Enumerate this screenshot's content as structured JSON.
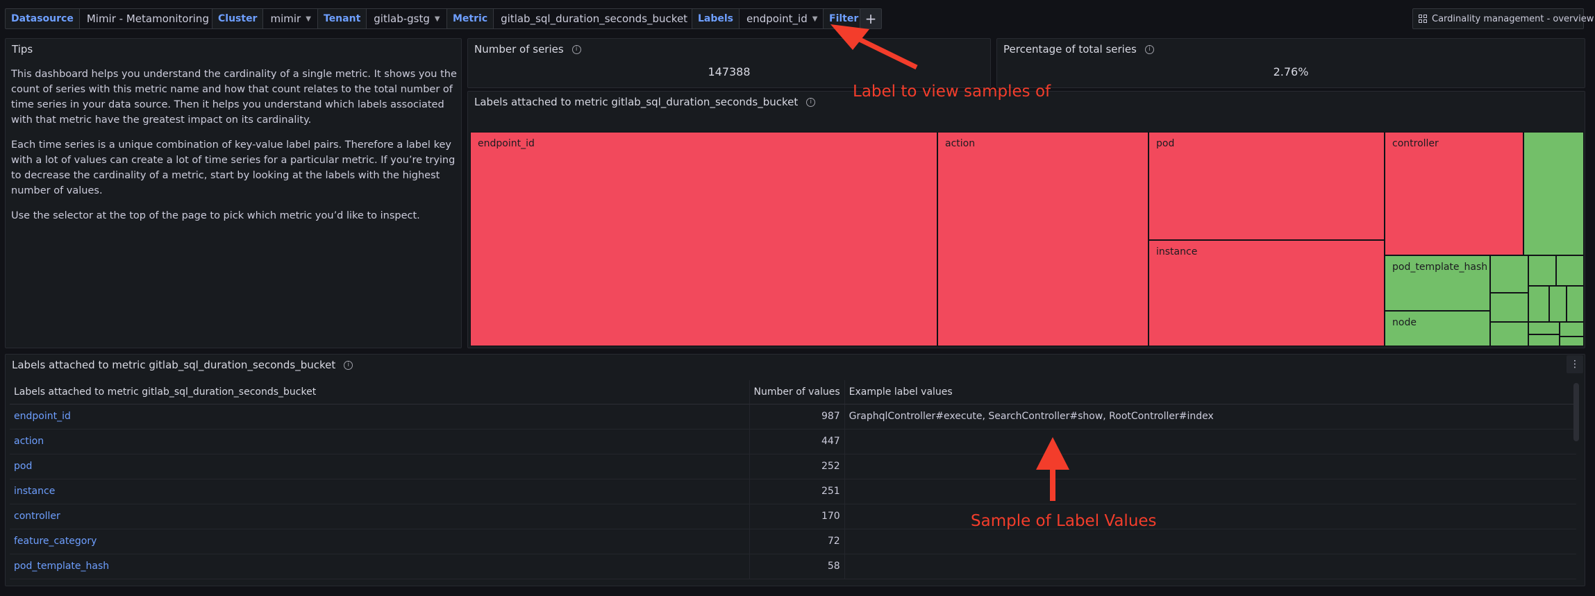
{
  "variables": [
    {
      "label": "Datasource",
      "value": "Mimir - Metamonitoring"
    },
    {
      "label": "Cluster",
      "value": "mimir"
    },
    {
      "label": "Tenant",
      "value": "gitlab-gstg"
    },
    {
      "label": "Metric",
      "value": "gitlab_sql_duration_seconds_bucket"
    },
    {
      "label": "Labels",
      "value": "endpoint_id"
    }
  ],
  "filter_label": "Filter",
  "add_filter_symbol": "+",
  "nav_button": "Cardinality management - overview",
  "tips": {
    "title": "Tips",
    "paragraphs": [
      "This dashboard helps you understand the cardinality of a single metric. It shows you the count of series with this metric name and how that count relates to the total number of time series in your data source. Then it helps you understand which labels associated with that metric have the greatest impact on its cardinality.",
      "Each time series is a unique combination of key-value label pairs. Therefore a label key with a lot of values can create a lot of time series for a particular metric. If you’re trying to decrease the cardinality of a metric, start by looking at the labels with the highest number of values.",
      "Use the selector at the top of the page to pick which metric you’d like to inspect."
    ]
  },
  "stats": {
    "series": {
      "title": "Number of series",
      "value": "147388"
    },
    "percentage": {
      "title": "Percentage of total series",
      "value": "2.76%"
    }
  },
  "treemap": {
    "title": "Labels attached to metric gitlab_sql_duration_seconds_bucket",
    "labels": {
      "endpoint_id": "endpoint_id",
      "action": "action",
      "pod": "pod",
      "instance": "instance",
      "controller": "controller",
      "pod_template_hash": "pod_template_hash",
      "node": "node"
    },
    "colors": {
      "high": "#f2495c",
      "low": "#73bf69"
    }
  },
  "table": {
    "title": "Labels attached to metric gitlab_sql_duration_seconds_bucket",
    "columns": [
      "Labels attached to metric gitlab_sql_duration_seconds_bucket",
      "Number of values",
      "Example label values"
    ],
    "rows": [
      {
        "label": "endpoint_id",
        "count": "987",
        "examples": "GraphqlController#execute, SearchController#show, RootController#index"
      },
      {
        "label": "action",
        "count": "447",
        "examples": ""
      },
      {
        "label": "pod",
        "count": "252",
        "examples": ""
      },
      {
        "label": "instance",
        "count": "251",
        "examples": ""
      },
      {
        "label": "controller",
        "count": "170",
        "examples": ""
      },
      {
        "label": "feature_category",
        "count": "72",
        "examples": ""
      },
      {
        "label": "pod_template_hash",
        "count": "58",
        "examples": ""
      }
    ]
  },
  "annotations": {
    "label_hint": "Label to view samples of",
    "values_hint": "Sample of Label Values"
  }
}
